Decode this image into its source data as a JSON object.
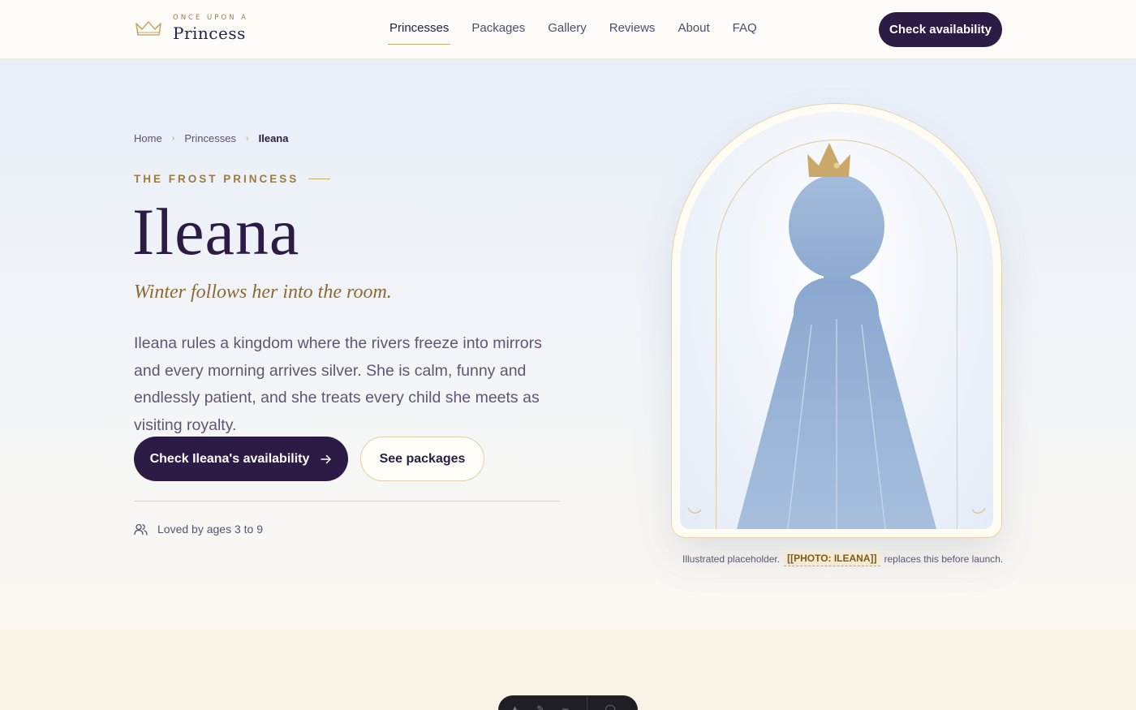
{
  "brand": {
    "tagline": "ONCE UPON A",
    "name": "Princess",
    "crown_color": "#c9a86a"
  },
  "nav": {
    "links": [
      "Princesses",
      "Packages",
      "Gallery",
      "Reviews",
      "About",
      "FAQ"
    ],
    "active": "Princesses",
    "cta": "Check availability"
  },
  "breadcrumb": [
    "Home",
    "Princesses",
    "Ileana"
  ],
  "hero": {
    "eyebrow": "THE FROST PRINCESS",
    "title": "Ileana",
    "tagline": "Winter follows her into the room.",
    "description": "Ileana rules a kingdom where the rivers freeze into mirrors and every morning arrives silver. She is calm, funny and endlessly patient, and she treats every child she meets as visiting royalty.",
    "primary_cta": "Check Ileana's availability",
    "secondary_cta": "See packages",
    "age_note": "Loved by ages 3 to 9"
  },
  "illustration": {
    "caption_before": "Illustrated placeholder.",
    "caption_tag": "[[PHOTO: ILEANA]]",
    "caption_after": "replaces this before launch.",
    "gown_color": "#8eaad0",
    "crown_color": "#c9a86a"
  },
  "icons": {
    "crown": "crown-icon",
    "chevron": "chevron-right-icon",
    "arrow": "arrow-right-icon",
    "users": "users-icon"
  },
  "colors": {
    "primary": "#2c1b45",
    "accent": "#c9a86a",
    "text_muted": "#605572"
  }
}
